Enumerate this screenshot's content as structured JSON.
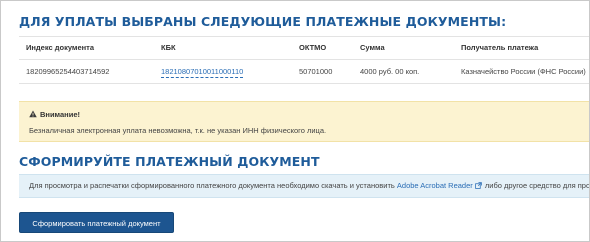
{
  "selected_docs": {
    "title": "ДЛЯ УПЛАТЫ ВЫБРАНЫ СЛЕДУЮЩИЕ ПЛАТЕЖНЫЕ ДОКУМЕНТЫ:",
    "columns": [
      "Индекс документа",
      "КБК",
      "ОКТМО",
      "Сумма",
      "Получатель платежа"
    ],
    "rows": [
      {
        "index": "18209965254403714592",
        "kbk": "18210807010011000110",
        "oktmo": "50701000",
        "amount": "4000 руб. 00 коп.",
        "recipient": "Казначейство России (ФНС России)"
      }
    ]
  },
  "warning": {
    "icon": "warning-triangle-icon",
    "title": "Внимание!",
    "text": "Безналичная электронная уплата невозможна, т.к. не указан ИНН физического лица.",
    "colors": {
      "background": "#fcf3d1",
      "border": "#f2e2a7"
    }
  },
  "generate": {
    "title": "СФОРМИРУЙТЕ ПЛАТЕЖНЫЙ ДОКУМЕНТ",
    "info_prefix": "Для просмотра и распечатки сформированного платежного документа необходимо скачать и установить",
    "info_link": "Adobe Acrobat Reader",
    "info_link_icon": "external-link-icon",
    "info_suffix": "либо другое средство для просмотра",
    "button_label": "Сформировать платежный документ",
    "colors": {
      "info_background": "#e5f1f8",
      "button": "#1d5590",
      "heading": "#1f5c9a",
      "link": "#2a6db5"
    }
  }
}
